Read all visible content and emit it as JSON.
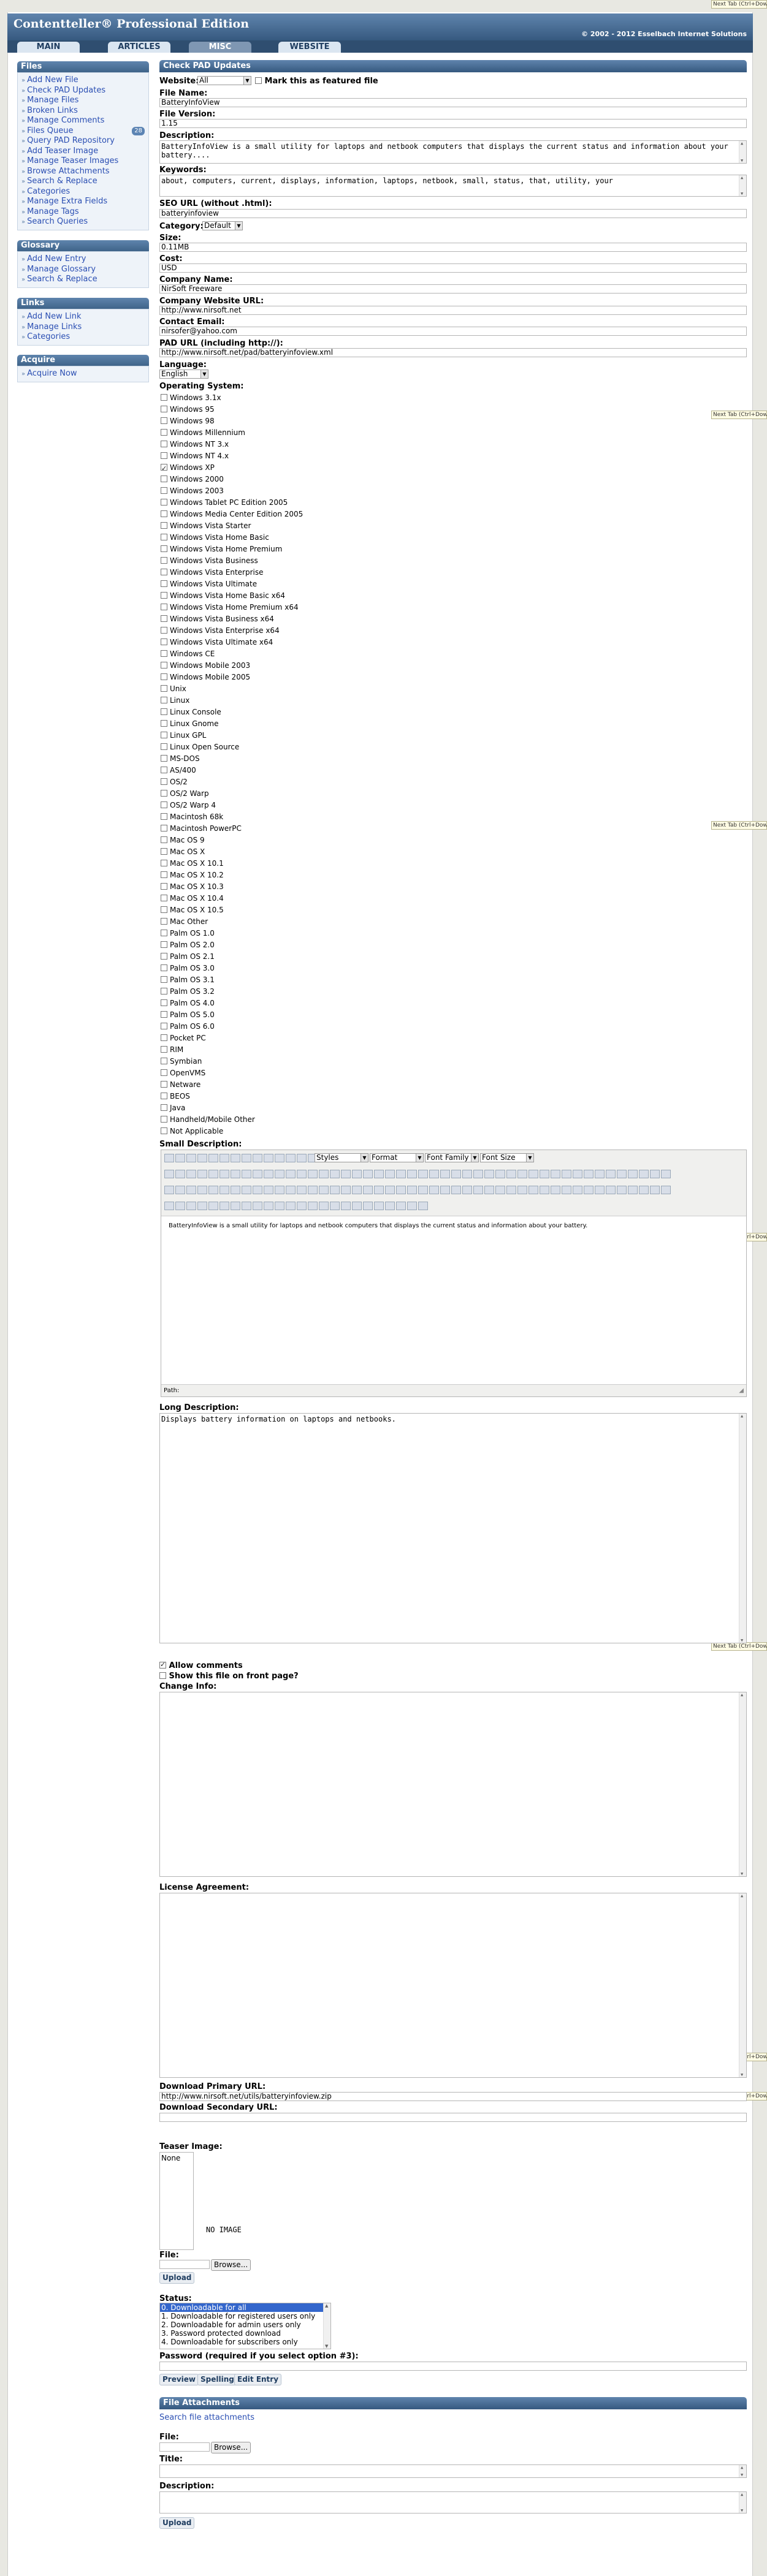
{
  "app_title": "Contentteller® Professional Edition",
  "copyright": "© 2002 - 2012 Esselbach Internet Solutions",
  "nav_tabs": [
    "MAIN",
    "ARTICLES",
    "MISC",
    "WEBSITE"
  ],
  "next_tab_label": "Next Tab (Ctrl+Down)",
  "sidebar": {
    "files": {
      "title": "Files",
      "items": [
        "Add New File",
        "Check PAD Updates",
        "Manage Files",
        "Broken Links",
        "Manage Comments",
        "Files Queue",
        "Query PAD Repository",
        "Add Teaser Image",
        "Manage Teaser Images",
        "Browse Attachments",
        "Search & Replace",
        "Categories",
        "Manage Extra Fields",
        "Manage Tags",
        "Search Queries"
      ],
      "queue_count": "28"
    },
    "glossary": {
      "title": "Glossary",
      "items": [
        "Add New Entry",
        "Manage Glossary",
        "Search & Replace"
      ]
    },
    "links": {
      "title": "Links",
      "items": [
        "Add New Link",
        "Manage Links",
        "Categories"
      ]
    },
    "acquire": {
      "title": "Acquire",
      "items": [
        "Acquire Now"
      ]
    }
  },
  "form": {
    "section_title": "Check PAD Updates",
    "website_label": "Website:",
    "website_value": "All",
    "featured_label": "Mark this as featured file",
    "file_name_label": "File Name:",
    "file_name": "BatteryInfoView",
    "file_version_label": "File Version:",
    "file_version": "1.15",
    "description_label": "Description:",
    "description": "BatteryInfoView is a small utility for laptops and netbook computers that displays the current status and information about your battery....",
    "keywords_label": "Keywords:",
    "keywords": "about, computers, current, displays, information, laptops, netbook, small, status, that, utility, your",
    "seo_label": "SEO URL (without .html):",
    "seo_url": "batteryinfoview",
    "category_label": "Category:",
    "category_value": "Default",
    "size_label": "Size:",
    "size": "0.11MB",
    "cost_label": "Cost:",
    "cost": "USD",
    "company_name_label": "Company Name:",
    "company_name": "NirSoft Freeware",
    "company_url_label": "Company Website URL:",
    "company_url": "http://www.nirsoft.net",
    "contact_email_label": "Contact Email:",
    "contact_email": "nirsofer@yahoo.com",
    "pad_url_label": "PAD URL (including http://):",
    "pad_url": "http://www.nirsoft.net/pad/batteryinfoview.xml",
    "language_label": "Language:",
    "language_value": "English",
    "os_label": "Operating System:",
    "os_list": [
      "Windows 3.1x",
      "Windows 95",
      "Windows 98",
      "Windows Millennium",
      "Windows NT 3.x",
      "Windows NT 4.x",
      "Windows XP",
      "Windows 2000",
      "Windows 2003",
      "Windows Tablet PC Edition 2005",
      "Windows Media Center Edition 2005",
      "Windows Vista Starter",
      "Windows Vista Home Basic",
      "Windows Vista Home Premium",
      "Windows Vista Business",
      "Windows Vista Enterprise",
      "Windows Vista Ultimate",
      "Windows Vista Home Basic x64",
      "Windows Vista Home Premium x64",
      "Windows Vista Business x64",
      "Windows Vista Enterprise x64",
      "Windows Vista Ultimate x64",
      "Windows CE",
      "Windows Mobile 2003",
      "Windows Mobile 2005",
      "Unix",
      "Linux",
      "Linux Console",
      "Linux Gnome",
      "Linux GPL",
      "Linux Open Source",
      "MS-DOS",
      "AS/400",
      "OS/2",
      "OS/2 Warp",
      "OS/2 Warp 4",
      "Macintosh 68k",
      "Macintosh PowerPC",
      "Mac OS 9",
      "Mac OS X",
      "Mac OS X 10.1",
      "Mac OS X 10.2",
      "Mac OS X 10.3",
      "Mac OS X 10.4",
      "Mac OS X 10.5",
      "Mac Other",
      "Palm OS 1.0",
      "Palm OS 2.0",
      "Palm OS 2.1",
      "Palm OS 3.0",
      "Palm OS 3.1",
      "Palm OS 3.2",
      "Palm OS 4.0",
      "Palm OS 5.0",
      "Palm OS 6.0",
      "Pocket PC",
      "RIM",
      "Symbian",
      "OpenVMS",
      "Netware",
      "BEOS",
      "Java",
      "Handheld/Mobile Other",
      "Not Applicable"
    ],
    "os_checked": [
      6
    ],
    "small_desc_label": "Small Description:",
    "editor_styles": "Styles",
    "editor_format": "Format",
    "editor_font_family": "Font Family",
    "editor_font_size": "Font Size",
    "small_desc": "BatteryInfoView is a small utility for laptops and netbook computers that displays the current status and information about your battery.",
    "path_label": "Path:",
    "long_desc_label": "Long Description:",
    "long_desc": "Displays battery information on laptops and netbooks.",
    "allow_comments": "Allow comments",
    "front_page": "Show this file on front page?",
    "change_info_label": "Change Info:",
    "license_label": "License Agreement:",
    "dl_primary_label": "Download Primary URL:",
    "dl_primary": "http://www.nirsoft.net/utils/batteryinfoview.zip",
    "dl_secondary_label": "Download Secondary URL:",
    "teaser_label": "Teaser Image:",
    "teaser_none": "None",
    "no_image": "NO IMAGE",
    "file_label": "File:",
    "browse": "Browse...",
    "upload": "Upload",
    "status_label": "Status:",
    "status_options": [
      "0.  Downloadable for all",
      "1.  Downloadable for registered users only",
      "2.  Downloadable for admin users only",
      "3.  Password protected download",
      "4.  Downloadable for subscribers only"
    ],
    "password_label": "Password (required if you select option #3):",
    "btn_preview": "Preview",
    "btn_spelling": "Spelling",
    "btn_edit_entry": "Edit Entry"
  },
  "attachments": {
    "title": "File Attachments",
    "search_link": "Search file attachments",
    "file_label": "File:",
    "browse": "Browse...",
    "title_label": "Title:",
    "desc_label": "Description:",
    "upload": "Upload"
  }
}
